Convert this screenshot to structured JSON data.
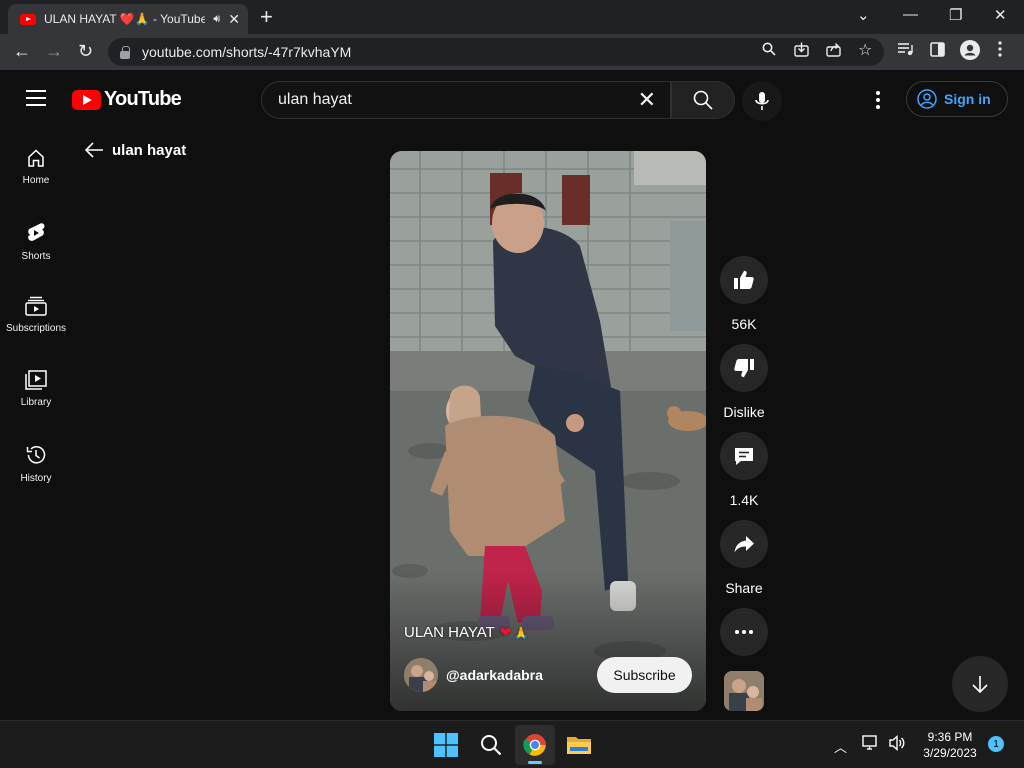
{
  "browser": {
    "tab_title": "ULAN HAYAT ❤️🙏 - YouTube",
    "url": "youtube.com/shorts/-47r7kvhaYM"
  },
  "masthead": {
    "logo_text": "YouTube",
    "search_query": "ulan hayat",
    "sign_in_label": "Sign in"
  },
  "sidebar": {
    "items": [
      {
        "label": "Home",
        "icon": "home-icon"
      },
      {
        "label": "Shorts",
        "icon": "shorts-icon"
      },
      {
        "label": "Subscriptions",
        "icon": "subscriptions-icon"
      },
      {
        "label": "Library",
        "icon": "library-icon"
      },
      {
        "label": "History",
        "icon": "history-icon"
      }
    ]
  },
  "main": {
    "back_label": "ulan hayat",
    "short": {
      "caption": "ULAN HAYAT",
      "caption_emoji_1": "❤",
      "caption_emoji_2": "🙏",
      "channel": "@adarkadabra",
      "subscribe_label": "Subscribe"
    },
    "actions": {
      "likes": "56K",
      "dislike_label": "Dislike",
      "comments": "1.4K",
      "share_label": "Share"
    }
  },
  "taskbar": {
    "time": "9:36 PM",
    "date": "3/29/2023",
    "notification_count": "1"
  },
  "colors": {
    "yt_red": "#ff0000",
    "link_blue": "#3ea6ff",
    "bg": "#0f0f0f"
  }
}
